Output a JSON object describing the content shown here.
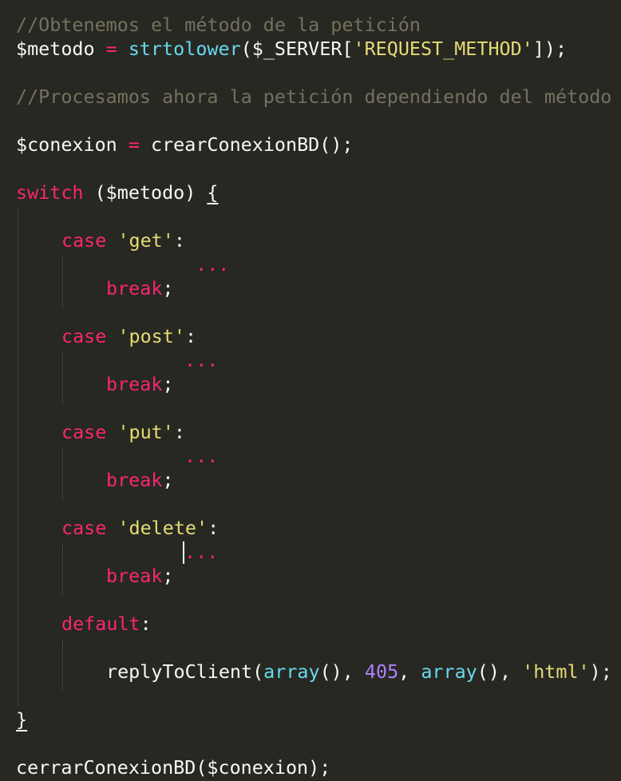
{
  "editor": {
    "background": "#272822",
    "colors": {
      "comment": "#75715e",
      "keyword": "#f92672",
      "function": "#66d9ef",
      "string": "#e6db74",
      "number": "#ae81ff",
      "text": "#f8f8f2"
    },
    "code": {
      "comment1": "//Obtenemos el método de la petición",
      "metodo_var": "$metodo",
      "assign1": " = ",
      "strtolower": "strtolower",
      "metodo_args_open": "($_SERVER[",
      "request_method": "'REQUEST_METHOD'",
      "metodo_args_close": "]);",
      "comment2": "//Procesamos ahora la petición dependiendo del método",
      "conexion_var": "$conexion",
      "assign2": " = ",
      "crear_call": "crearConexionBD();",
      "switch_kw": "switch",
      "switch_args": " ($metodo) ",
      "brace_open": "{",
      "case_kw": "case",
      "case_get": "'get'",
      "case_post": "'post'",
      "case_put": "'put'",
      "case_delete": "'delete'",
      "colon": ":",
      "ellipsis": "...",
      "break_kw": "break",
      "semicolon": ";",
      "default_kw": "default",
      "reply_fn": "replyToClient(",
      "array_kw": "array",
      "parens": "()",
      "comma_space": ", ",
      "status_code": "405",
      "html_str": "'html'",
      "reply_close": ");",
      "brace_close": "}",
      "cerrar_call": "cerrarConexionBD($conexion);"
    }
  }
}
